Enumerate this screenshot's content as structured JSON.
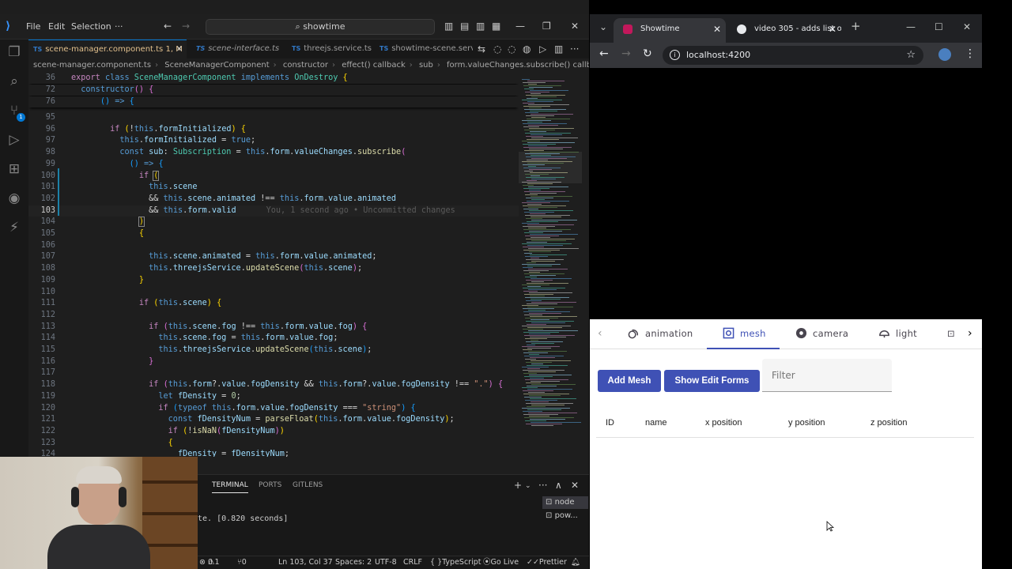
{
  "vscode": {
    "menu": [
      "File",
      "Edit",
      "Selection"
    ],
    "command_center": "showtime",
    "tabs": [
      {
        "label": "scene-manager.component.ts",
        "suffix": "1, M",
        "active": true
      },
      {
        "label": "scene-interface.ts",
        "active": false
      },
      {
        "label": "threejs.service.ts",
        "active": false
      },
      {
        "label": "showtime-scene.serv",
        "active": false
      }
    ],
    "breadcrumb": [
      "scene-manager.component.ts",
      "SceneManagerComponent",
      "constructor",
      "effect() callback",
      "sub",
      "form.valueChanges.subscribe() callback"
    ],
    "activity_badge": "1",
    "code_lines": [
      {
        "n": "36",
        "sticky": true
      },
      {
        "n": "72",
        "sticky": true
      },
      {
        "n": "76",
        "sticky": true
      },
      {
        "n": "95"
      },
      {
        "n": "96"
      },
      {
        "n": "97"
      },
      {
        "n": "98"
      },
      {
        "n": "99"
      },
      {
        "n": "100"
      },
      {
        "n": "101"
      },
      {
        "n": "102"
      },
      {
        "n": "103",
        "current": true
      },
      {
        "n": "104"
      },
      {
        "n": "105"
      },
      {
        "n": "106"
      },
      {
        "n": "107"
      },
      {
        "n": "108"
      },
      {
        "n": "109"
      },
      {
        "n": "110"
      },
      {
        "n": "111"
      },
      {
        "n": "112"
      },
      {
        "n": "113"
      },
      {
        "n": "114"
      },
      {
        "n": "115"
      },
      {
        "n": "116"
      },
      {
        "n": "117"
      },
      {
        "n": "118"
      },
      {
        "n": "119"
      },
      {
        "n": "120"
      },
      {
        "n": "121"
      },
      {
        "n": "122"
      },
      {
        "n": "123"
      },
      {
        "n": "124"
      }
    ],
    "blame": "You, 1 second ago • Uncommitted changes",
    "panel": {
      "tabs": [
        "TERMINAL",
        "PORTS",
        "GITLENS"
      ],
      "terminal_text": "te. [0.820 seconds]",
      "terminals": [
        "node",
        "pow..."
      ]
    },
    "status": {
      "problems": "0",
      "warnings": "1",
      "ports": "0",
      "position": "Ln 103, Col 37",
      "spaces": "Spaces: 2",
      "encoding": "UTF-8",
      "eol": "CRLF",
      "language": "TypeScript",
      "golive": "Go Live",
      "prettier": "Prettier"
    }
  },
  "chrome": {
    "tabs": [
      {
        "label": "Showtime",
        "active": true,
        "favicon_color": "#c2185b"
      },
      {
        "label": "video 305 - adds list o",
        "active": false,
        "favicon_color": "#e8eaed"
      }
    ],
    "url": "localhost:4200",
    "app": {
      "tabs": [
        {
          "label": "animation",
          "icon": "animation-icon",
          "active": false
        },
        {
          "label": "mesh",
          "icon": "mesh-icon",
          "active": true
        },
        {
          "label": "camera",
          "icon": "camera-icon",
          "active": false
        },
        {
          "label": "light",
          "icon": "light-icon",
          "active": false
        }
      ],
      "add_mesh": "Add Mesh",
      "show_edit_forms": "Show Edit Forms",
      "filter_placeholder": "Filter",
      "columns": [
        "ID",
        "name",
        "x position",
        "y position",
        "z position"
      ],
      "accent": "#3f51b5"
    }
  }
}
